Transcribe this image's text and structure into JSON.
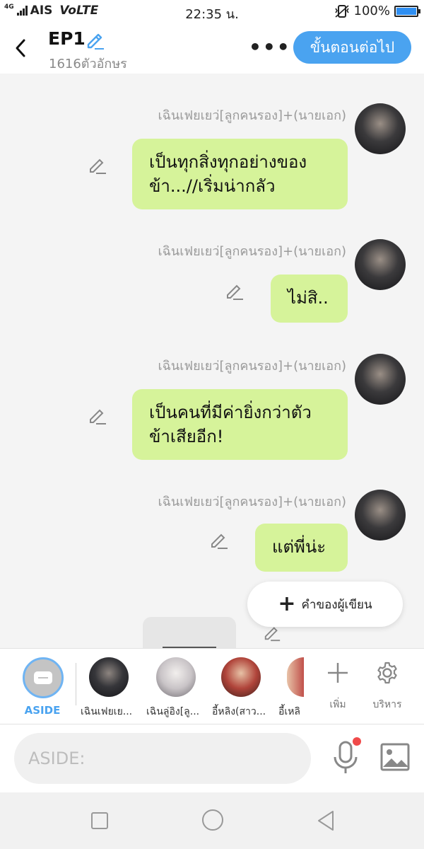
{
  "status": {
    "network": "4G",
    "carrier": "AIS",
    "volte": "VoLTE",
    "time": "22:35 น.",
    "battery": "100%",
    "battery_level": 1.0
  },
  "header": {
    "title": "EP1",
    "char_count": "1616ตัวอักษร",
    "more_label": "•••",
    "next_button": "ขั้นตอนต่อไป"
  },
  "messages": [
    {
      "sender": "เฉินเฟยเยว่[ลูกคนรอง]+(นายเอก)",
      "lines": [
        "เป็นทุกสิ่งทุกอย่างของ",
        "ข้า...//เริ่มน่ากลัว"
      ]
    },
    {
      "sender": "เฉินเฟยเยว่[ลูกคนรอง]+(นายเอก)",
      "lines": [
        "ไม่สิ.."
      ]
    },
    {
      "sender": "เฉินเฟยเยว่[ลูกคนรอง]+(นายเอก)",
      "lines": [
        "เป็นคนที่มีค่ายิ่งกว่าตัว",
        "ข้าเสียอีก!"
      ]
    },
    {
      "sender": "เฉินเฟยเยว่[ลูกคนรอง]+(นายเอก)",
      "lines": [
        "แต่พี่น่ะ"
      ]
    }
  ],
  "author_button": {
    "plus": "+",
    "label": "คำของผู้เขียน"
  },
  "characters": {
    "aside_label": "ASIDE",
    "items": [
      {
        "name": "เฉินเฟยเย...",
        "color": "#2b2a2e"
      },
      {
        "name": "เฉินลู่อิง[ลู...",
        "color": "#d9d6d8"
      },
      {
        "name": "อี้หลิง(สาว...",
        "color": "#b0443a"
      },
      {
        "name": "อี้เหลิ",
        "color": "#c0504a"
      }
    ],
    "add_label": "เพิ่ม",
    "manage_label": "บริหาร"
  },
  "input": {
    "placeholder": "ASIDE:"
  },
  "colors": {
    "accent": "#4aa3f0",
    "bubble": "#d6f39a",
    "mic_dot": "#f04a4a"
  }
}
